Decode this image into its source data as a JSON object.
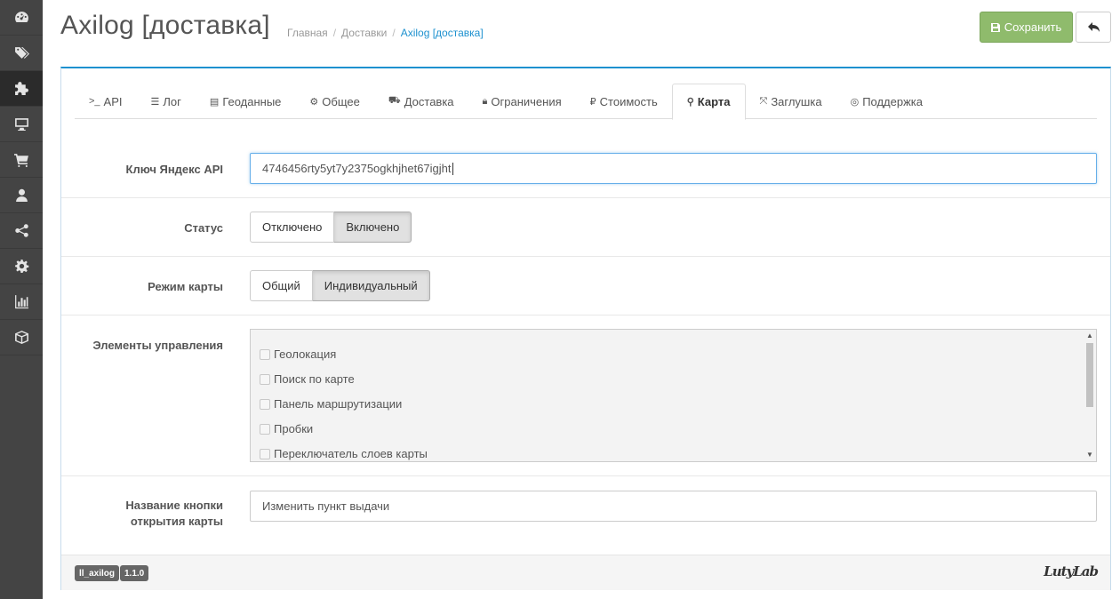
{
  "sidebar": {
    "items": [
      {
        "icon": "dashboard-icon"
      },
      {
        "icon": "tags-icon"
      },
      {
        "icon": "puzzle-icon",
        "active": true
      },
      {
        "icon": "desktop-icon"
      },
      {
        "icon": "cart-icon"
      },
      {
        "icon": "user-icon"
      },
      {
        "icon": "share-icon"
      },
      {
        "icon": "gear-icon"
      },
      {
        "icon": "bar-chart-icon"
      },
      {
        "icon": "cube-icon"
      }
    ]
  },
  "header": {
    "title": "Axilog [доставка]",
    "breadcrumb": [
      "Главная",
      "Доставки",
      "Axilog [доставка]"
    ],
    "save_label": "Сохранить",
    "back_icon": "reply-icon"
  },
  "tabs": [
    {
      "label": "API",
      "icon": ">_"
    },
    {
      "label": "Лог",
      "icon": "☰"
    },
    {
      "label": "Геоданные",
      "icon": "▤"
    },
    {
      "label": "Общее",
      "icon": "⚙"
    },
    {
      "label": "Доставка",
      "icon": "⛟"
    },
    {
      "label": "Ограничения",
      "icon": "🔒︎"
    },
    {
      "label": "Стоимость",
      "icon": "₽"
    },
    {
      "label": "Карта",
      "icon": "⚲",
      "active": true
    },
    {
      "label": "Заглушка",
      "icon": "⤧"
    },
    {
      "label": "Поддержка",
      "icon": "◎"
    }
  ],
  "form": {
    "api_key_label": "Ключ Яндекс API",
    "api_key_value": "4746456rty5yt7y2375ogkhjhet67igjht",
    "status_label": "Статус",
    "status_options": [
      "Отключено",
      "Включено"
    ],
    "status_selected": "Включено",
    "map_mode_label": "Режим карты",
    "map_mode_options": [
      "Общий",
      "Индивидуальный"
    ],
    "map_mode_selected": "Индивидуальный",
    "controls_label": "Элементы управления",
    "controls": [
      {
        "label": "Геолокация",
        "checked": false
      },
      {
        "label": "Поиск по карте",
        "checked": false
      },
      {
        "label": "Панель маршрутизации",
        "checked": false
      },
      {
        "label": "Пробки",
        "checked": false
      },
      {
        "label": "Переключатель слоев карты",
        "checked": false
      }
    ],
    "button_name_label_line1": "Название кнопки",
    "button_name_label_line2": "открытия карты",
    "button_name_value": "Изменить пункт выдачи"
  },
  "footer": {
    "module_code": "ll_axilog",
    "version": "1.1.0",
    "brand": "LutyLab"
  },
  "colors": {
    "save": "#8fbb6c",
    "accent": "#1e91cf",
    "sidebar": "#444444"
  }
}
